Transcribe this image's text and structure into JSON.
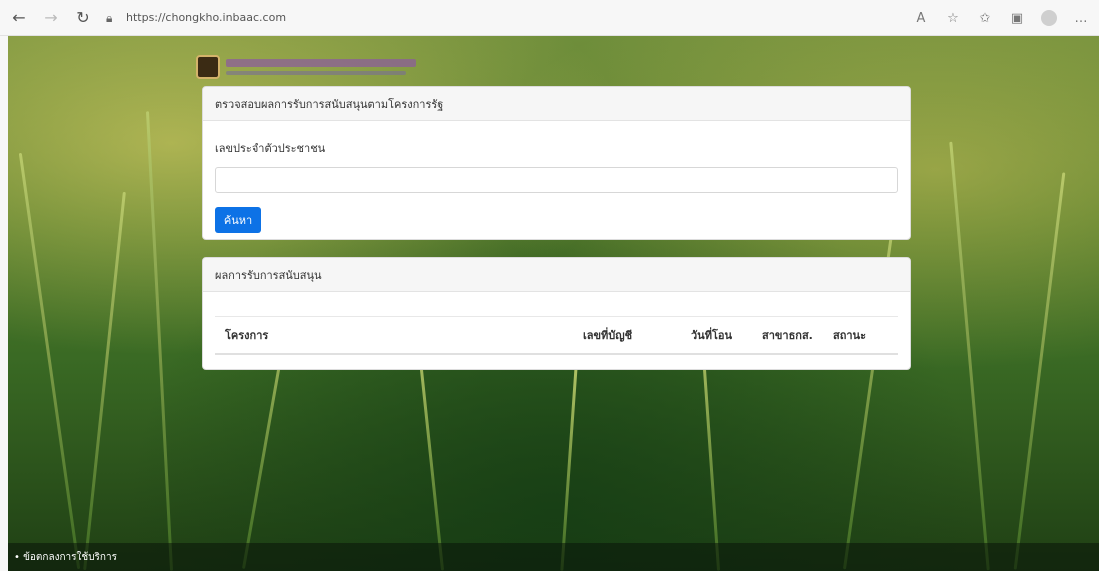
{
  "browser": {
    "url": "https://chongkho.inbaac.com"
  },
  "search": {
    "header": "ตรวจสอบผลการรับการสนับสนุนตามโครงการรัฐ",
    "field_label": "เลขประจำตัวประชาชน",
    "button_label": "ค้นหา"
  },
  "results": {
    "header": "ผลการรับการสนับสนุน",
    "columns": [
      "โครงการ",
      "เลขที่บัญชี",
      "วันที่โอน",
      "สาขาธกส.",
      "สถานะ"
    ]
  },
  "footer": {
    "link": "• ข้อตกลงการใช้บริการ"
  },
  "colors": {
    "primary_button": "#0d72e6"
  }
}
